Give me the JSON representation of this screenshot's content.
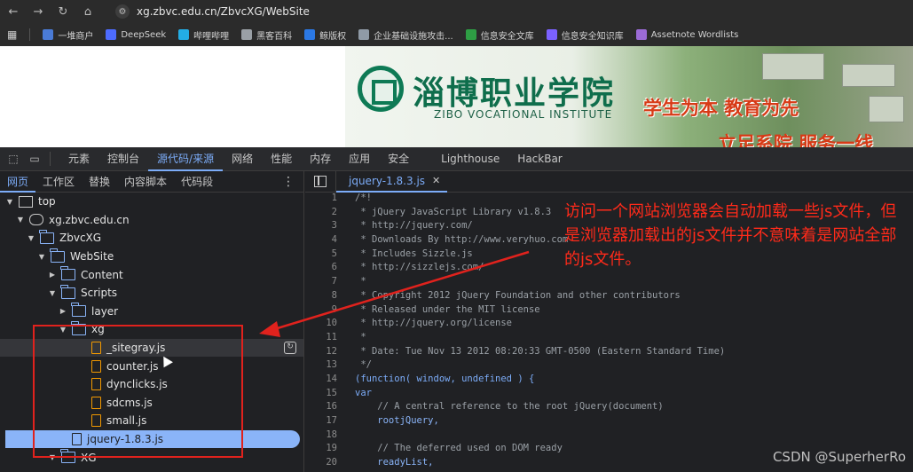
{
  "browser": {
    "nav": {
      "back": "←",
      "forward": "→",
      "reload": "↻",
      "home": "⌂"
    },
    "url": "xg.zbvc.edu.cn/ZbvcXG/WebSite",
    "bookmarks": [
      {
        "label": "一堆商户",
        "color": "#4a7bd6"
      },
      {
        "label": "DeepSeek",
        "color": "#4d6bfe"
      },
      {
        "label": "哔哩哔哩",
        "color": "#23ade5"
      },
      {
        "label": "黑客百科",
        "color": "#9aa0a6"
      },
      {
        "label": "鲸版权",
        "color": "#2b78e4"
      },
      {
        "label": "企业基础设施攻击...",
        "color": "#8f9aa6"
      },
      {
        "label": "信息安全文库",
        "color": "#2e9e44"
      },
      {
        "label": "信息安全知识库",
        "color": "#7b61ff"
      },
      {
        "label": "Assetnote Wordlists",
        "color": "#9b6bd6"
      }
    ]
  },
  "banner": {
    "title": "淄博职业学院",
    "subtitle": "ZIBO VOCATIONAL INSTITUTE",
    "slogan": "学生为本  教育为先",
    "slogan2": "立足系院  服务一线"
  },
  "devtools": {
    "tabs": [
      "元素",
      "控制台",
      "源代码/来源",
      "网络",
      "性能",
      "内存",
      "应用",
      "安全",
      "Lighthouse",
      "HackBar"
    ],
    "active_tab": "源代码/来源",
    "sub_tabs": [
      "网页",
      "工作区",
      "替换",
      "内容脚本",
      "代码段"
    ],
    "active_sub_tab": "网页",
    "more_icon": "⋮",
    "tree": [
      {
        "label": "top",
        "depth": 0,
        "type": "frame",
        "arrow": "▼"
      },
      {
        "label": "xg.zbvc.edu.cn",
        "depth": 1,
        "type": "cloud",
        "arrow": "▼"
      },
      {
        "label": "ZbvcXG",
        "depth": 2,
        "type": "folder",
        "arrow": "▼"
      },
      {
        "label": "WebSite",
        "depth": 3,
        "type": "folder",
        "arrow": "▼"
      },
      {
        "label": "Content",
        "depth": 4,
        "type": "folder",
        "arrow": "▶"
      },
      {
        "label": "Scripts",
        "depth": 4,
        "type": "folder",
        "arrow": "▼"
      },
      {
        "label": "layer",
        "depth": 5,
        "type": "folder",
        "arrow": "▶"
      },
      {
        "label": "xg",
        "depth": 5,
        "type": "folder",
        "arrow": "▼"
      },
      {
        "label": "_sitegray.js",
        "depth": 6,
        "type": "file",
        "arrow": "",
        "state": "hover"
      },
      {
        "label": "counter.js",
        "depth": 6,
        "type": "file",
        "arrow": ""
      },
      {
        "label": "dynclicks.js",
        "depth": 6,
        "type": "file",
        "arrow": ""
      },
      {
        "label": "sdcms.js",
        "depth": 6,
        "type": "file",
        "arrow": ""
      },
      {
        "label": "small.js",
        "depth": 6,
        "type": "file",
        "arrow": ""
      },
      {
        "label": "jquery-1.8.3.js",
        "depth": 5,
        "type": "file",
        "arrow": "",
        "state": "selected"
      },
      {
        "label": "XG",
        "depth": 4,
        "type": "folder",
        "arrow": "▼"
      }
    ],
    "editor": {
      "open_tab": "jquery-1.8.3.js",
      "close_icon": "✕",
      "lines": [
        {
          "n": "1",
          "t": "/*!"
        },
        {
          "n": "2",
          "t": " * jQuery JavaScript Library v1.8.3"
        },
        {
          "n": "3",
          "t": " * http://jquery.com/"
        },
        {
          "n": "4",
          "t": " * Downloads By http://www.veryhuo.com"
        },
        {
          "n": "5",
          "t": " * Includes Sizzle.js"
        },
        {
          "n": "6",
          "t": " * http://sizzlejs.com/"
        },
        {
          "n": "7",
          "t": " *"
        },
        {
          "n": "8",
          "t": " * Copyright 2012 jQuery Foundation and other contributors"
        },
        {
          "n": "9",
          "t": " * Released under the MIT license"
        },
        {
          "n": "10",
          "t": " * http://jquery.org/license"
        },
        {
          "n": "11",
          "t": " *"
        },
        {
          "n": "12",
          "t": " * Date: Tue Nov 13 2012 08:20:33 GMT-0500 (Eastern Standard Time)"
        },
        {
          "n": "13",
          "t": " */"
        },
        {
          "n": "14",
          "t": "(function( window, undefined ) {"
        },
        {
          "n": "15",
          "t": "var"
        },
        {
          "n": "16",
          "t": "    // A central reference to the root jQuery(document)"
        },
        {
          "n": "17",
          "t": "    rootjQuery,"
        },
        {
          "n": "18",
          "t": ""
        },
        {
          "n": "19",
          "t": "    // The deferred used on DOM ready"
        },
        {
          "n": "20",
          "t": "    readyList,"
        }
      ]
    }
  },
  "annotation": {
    "text": "访问一个网站浏览器会自动加载一些js文件，但是浏览器加载出的js文件并不意味着是网站全部的js文件。",
    "color": "#ff2a1a"
  },
  "watermark": "CSDN @SuperherRo"
}
